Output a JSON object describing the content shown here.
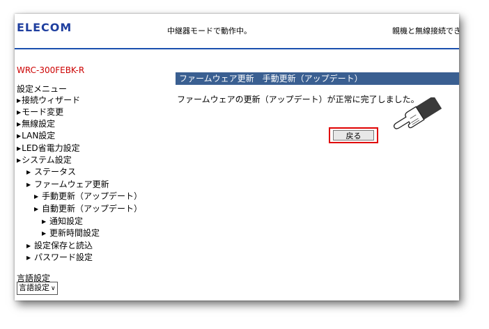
{
  "header": {
    "logo": "ELECOM",
    "status": "中継器モードで動作中。",
    "connection": "親機と無線接続でき"
  },
  "sidebar": {
    "model": "WRC-300FEBK-R",
    "menu_title": "設定メニュー",
    "items": [
      {
        "label": "接続ウィザード"
      },
      {
        "label": "モード変更"
      },
      {
        "label": "無線設定"
      },
      {
        "label": "LAN設定"
      },
      {
        "label": "LED省電力設定"
      },
      {
        "label": "システム設定"
      },
      {
        "label": "ステータス"
      },
      {
        "label": "ファームウェア更新"
      },
      {
        "label": "手動更新（アップデート）"
      },
      {
        "label": "自動更新（アップデート）"
      },
      {
        "label": "通知設定"
      },
      {
        "label": "更新時間設定"
      },
      {
        "label": "設定保存と読込"
      },
      {
        "label": "パスワード設定"
      }
    ],
    "language_label": "言語設定",
    "language_select": "言語設定"
  },
  "main": {
    "title": "ファームウェア更新　手動更新（アップデート）",
    "message": "ファームウェアの更新（アップデート）が正常に完了しました。",
    "back_button": "戻る"
  },
  "colors": {
    "logo": "#1f3f9f",
    "rule": "#1a4fae",
    "model": "#cc0000",
    "titlebar": "#3a5f91",
    "highlight": "#e00000"
  },
  "icons": {
    "pointer": "pointing-hand-icon",
    "arrow": "triangle-right-icon"
  }
}
